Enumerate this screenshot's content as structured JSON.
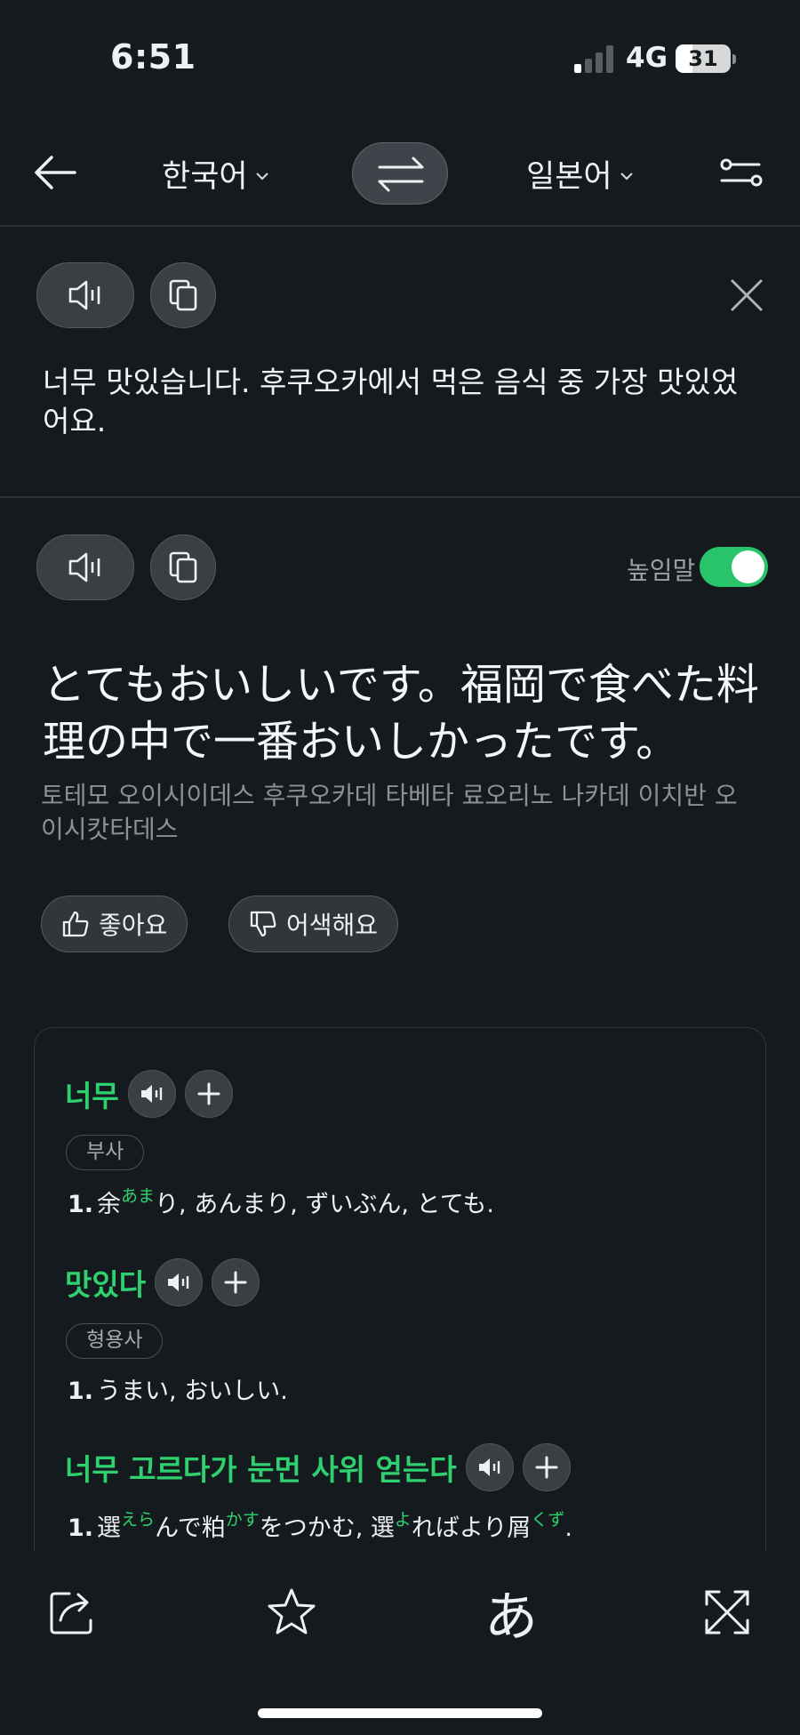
{
  "status_bar": {
    "time": "6:51",
    "network": "4G",
    "battery": "31"
  },
  "nav": {
    "source_lang": "한국어",
    "target_lang": "일본어"
  },
  "source": {
    "text": "너무 맛있습니다. 후쿠오카에서 먹은 음식 중 가장 맛있었어요."
  },
  "result": {
    "honorific_label": "높임말",
    "honorific_on": true,
    "translation": "とてもおいしいです。福岡で食べた料理の中で一番おいしかったです。",
    "pronunciation": "토테모 오이시이데스 후쿠오카데 타베타 료오리노 나카데 이치반 오이시캇타데스",
    "like_label": "좋아요",
    "awkward_label": "어색해요"
  },
  "dictionary": [
    {
      "word": "너무",
      "pos": "부사",
      "def_num": "1.",
      "def_parts": [
        {
          "t": "余"
        },
        {
          "r": "あま"
        },
        {
          "t": "り, あんまり, ずいぶん, とても."
        }
      ]
    },
    {
      "word": "맛있다",
      "pos": "형용사",
      "def_num": "1.",
      "def_parts": [
        {
          "t": "うまい, おいしい."
        }
      ]
    },
    {
      "word": "너무 고르다가 눈먼 사위 얻는다",
      "pos": "",
      "def_num": "1.",
      "def_parts": [
        {
          "t": "選"
        },
        {
          "r": "えら"
        },
        {
          "t": "んで粕"
        },
        {
          "r": "かす"
        },
        {
          "t": "をつかむ, 選"
        },
        {
          "r": "よ"
        },
        {
          "t": "ればより屑"
        },
        {
          "r": "くず"
        },
        {
          "t": "."
        }
      ]
    }
  ],
  "bottom_bar": {
    "kana_label": "あ"
  },
  "icons": {
    "back": "arrow-left-icon",
    "swap": "swap-arrows-icon",
    "settings": "sliders-icon",
    "speaker": "speaker-icon",
    "copy": "copy-icon",
    "close": "close-icon",
    "thumbs_up": "thumbs-up-icon",
    "thumbs_down": "thumbs-down-icon",
    "add": "plus-icon",
    "share": "share-icon",
    "star": "star-icon",
    "expand": "expand-icon"
  },
  "colors": {
    "accent": "#2fd06f",
    "background": "#151a1e"
  }
}
